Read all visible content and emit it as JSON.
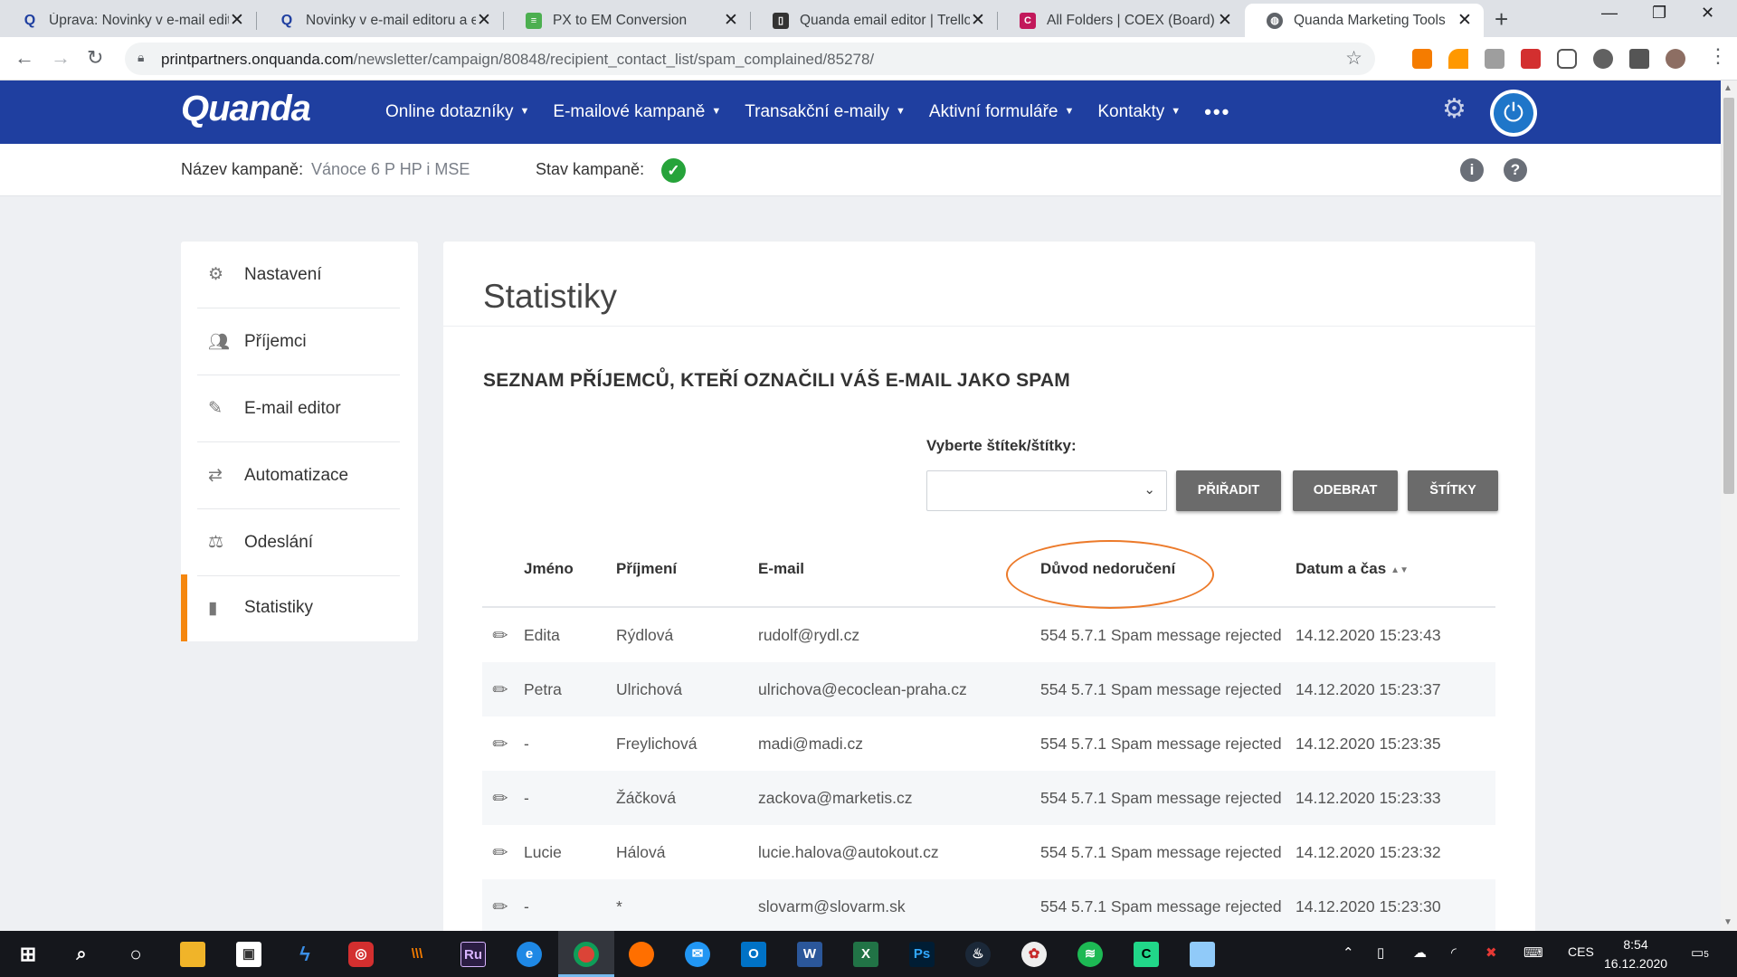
{
  "browser": {
    "tabs": [
      {
        "title": "Úprava: Novinky v e-mail editoru",
        "active": false
      },
      {
        "title": "Novinky v e-mail editoru a e-",
        "active": false
      },
      {
        "title": "PX to EM Conversion",
        "active": false
      },
      {
        "title": "Quanda email editor | Trello",
        "active": false
      },
      {
        "title": "All Folders | COEX (Board)",
        "active": false
      },
      {
        "title": "Quanda Marketing Tools",
        "active": true
      }
    ],
    "url_host": "printpartners.onquanda.com",
    "url_path": "/newsletter/campaign/80848/recipient_contact_list/spam_complained/85278/"
  },
  "app": {
    "logo": "Quanda",
    "menu": [
      {
        "label": "Online dotazníky"
      },
      {
        "label": "E-mailové kampaně"
      },
      {
        "label": "Transakční e-maily"
      },
      {
        "label": "Aktivní formuláře"
      },
      {
        "label": "Kontakty"
      }
    ]
  },
  "campaign": {
    "name_label": "Název kampaně:",
    "name_value": "Vánoce 6 P HP i MSE",
    "status_label": "Stav kampaně:"
  },
  "sidebar": {
    "items": [
      {
        "label": "Nastavení",
        "icon": "gear-icon"
      },
      {
        "label": "Příjemci",
        "icon": "users-icon"
      },
      {
        "label": "E-mail editor",
        "icon": "edit-icon"
      },
      {
        "label": "Automatizace",
        "icon": "repeat-icon"
      },
      {
        "label": "Odeslání",
        "icon": "send-icon"
      },
      {
        "label": "Statistiky",
        "icon": "bar-chart-icon",
        "active": true
      }
    ]
  },
  "main": {
    "title": "Statistiky",
    "section_title": "SEZNAM PŘÍJEMCŮ, KTEŘÍ OZNAČILI VÁŠ E-MAIL JAKO SPAM",
    "tag_label": "Vyberte štítek/štítky:",
    "buttons": {
      "assign": "PŘIŘADIT",
      "remove": "ODEBRAT",
      "tags": "ŠTÍTKY"
    },
    "columns": {
      "first_name": "Jméno",
      "last_name": "Příjmení",
      "email": "E-mail",
      "reason": "Důvod nedoručení",
      "datetime": "Datum a čas"
    },
    "rows": [
      {
        "first": "Edita",
        "last": "Rýdlová",
        "email": "rudolf@rydl.cz",
        "reason": "554 5.7.1 Spam message rejected",
        "date": "14.12.2020 15:23:43"
      },
      {
        "first": "Petra",
        "last": "Ulrichová",
        "email": "ulrichova@ecoclean-praha.cz",
        "reason": "554 5.7.1 Spam message rejected",
        "date": "14.12.2020 15:23:37"
      },
      {
        "first": "-",
        "last": "Freylichová",
        "email": "madi@madi.cz",
        "reason": "554 5.7.1 Spam message rejected",
        "date": "14.12.2020 15:23:35"
      },
      {
        "first": "-",
        "last": "Žáčková",
        "email": "zackova@marketis.cz",
        "reason": "554 5.7.1 Spam message rejected",
        "date": "14.12.2020 15:23:33"
      },
      {
        "first": "Lucie",
        "last": "Hálová",
        "email": "lucie.halova@autokout.cz",
        "reason": "554 5.7.1 Spam message rejected",
        "date": "14.12.2020 15:23:32"
      },
      {
        "first": "-",
        "last": "*",
        "email": "slovarm@slovarm.sk",
        "reason": "554 5.7.1 Spam message rejected",
        "date": "14.12.2020 15:23:30"
      }
    ]
  },
  "taskbar": {
    "lang": "CES",
    "time": "8:54",
    "date": "16.12.2020",
    "notifications": "5"
  },
  "colors": {
    "brand_blue": "#1f3fa0",
    "accent_orange": "#f5870f",
    "annotation": "#ec7a2a",
    "success": "#26a33a"
  }
}
